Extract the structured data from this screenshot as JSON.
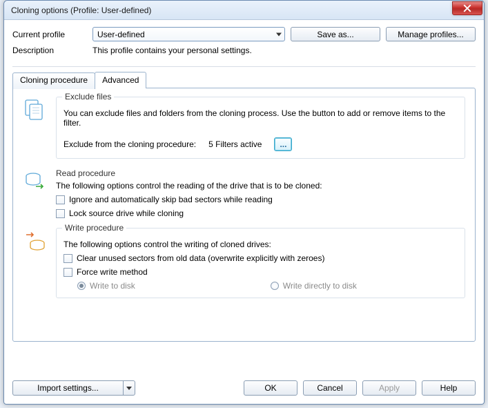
{
  "window": {
    "title": "Cloning options (Profile: User-defined)"
  },
  "profile": {
    "label": "Current profile",
    "value": "User-defined",
    "save_as": "Save as...",
    "manage": "Manage profiles..."
  },
  "description": {
    "label": "Description",
    "text": "This profile contains your personal settings."
  },
  "tabs": {
    "cloning": "Cloning procedure",
    "advanced": "Advanced"
  },
  "exclude": {
    "legend": "Exclude files",
    "text": "You can exclude files and folders from the cloning process. Use the button to add or remove items to the filter.",
    "label": "Exclude from the cloning procedure:",
    "status": "5 Filters active",
    "btn": "..."
  },
  "read": {
    "legend": "Read procedure",
    "text": "The following options control the reading of the drive that is to be cloned:",
    "opt1": "Ignore and automatically skip bad sectors while reading",
    "opt2": "Lock source drive while cloning"
  },
  "write": {
    "legend": "Write procedure",
    "text": "The following options control the writing of cloned drives:",
    "opt1": "Clear unused sectors from old data (overwrite explicitly with zeroes)",
    "opt2": "Force write method",
    "radio1": "Write to disk",
    "radio2": "Write directly to disk"
  },
  "footer": {
    "import": "Import settings...",
    "ok": "OK",
    "cancel": "Cancel",
    "apply": "Apply",
    "help": "Help"
  }
}
